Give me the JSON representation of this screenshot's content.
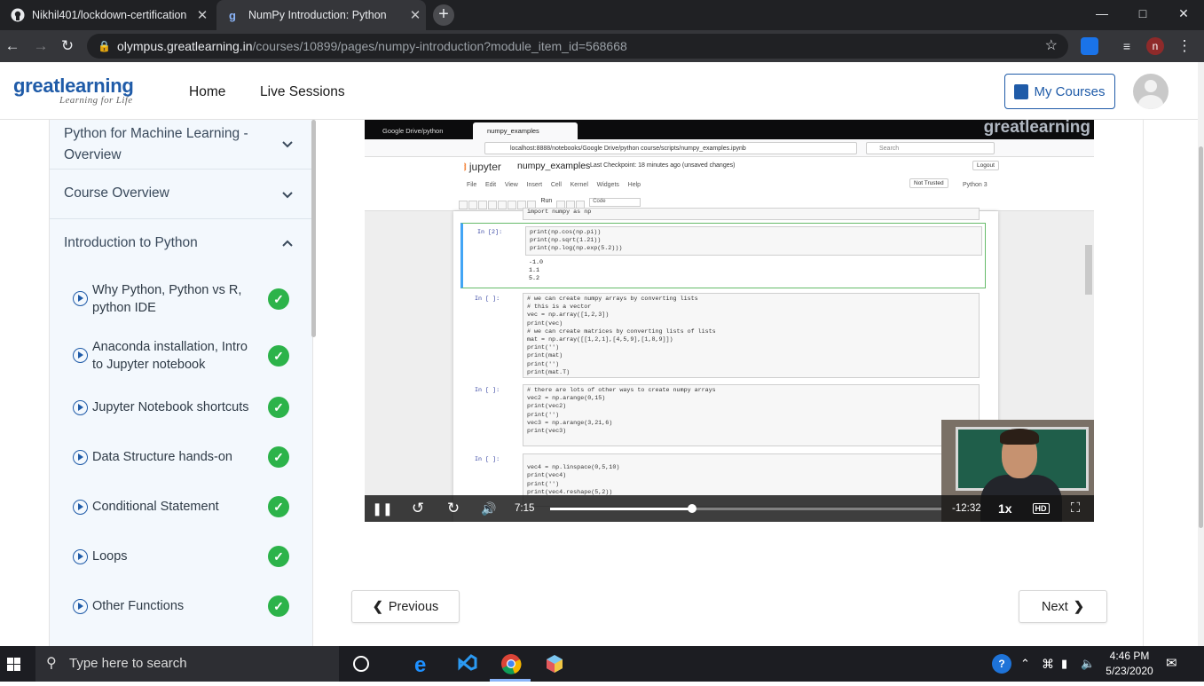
{
  "browser": {
    "tabs": [
      {
        "title": "Nikhil401/lockdown-certification",
        "close": "✕",
        "icon": "github-icon"
      },
      {
        "title": "NumPy Introduction: Python",
        "close": "✕",
        "icon": "greatlearning-icon"
      }
    ],
    "new_tab": "+",
    "url_host": "olympus.greatlearning.in",
    "url_path": "/courses/10899/pages/numpy-introduction?module_item_id=568668",
    "profile_initial": "n"
  },
  "header": {
    "logo_main": "greatlearning",
    "logo_sub": "Learning for Life",
    "nav": [
      "Home",
      "Live Sessions"
    ],
    "my_courses": "My Courses"
  },
  "sidebar": {
    "sections": [
      {
        "title": "Python for Machine Learning - Overview",
        "expanded": false
      },
      {
        "title": "Course Overview",
        "expanded": false
      },
      {
        "title": "Introduction to Python",
        "expanded": true
      }
    ],
    "lessons": [
      {
        "title": "Why Python, Python vs R, python IDE",
        "done": true
      },
      {
        "title": "Anaconda installation, Intro to Jupyter notebook",
        "done": true
      },
      {
        "title": "Jupyter Notebook shortcuts",
        "done": true
      },
      {
        "title": "Data Structure hands-on",
        "done": true
      },
      {
        "title": "Conditional Statement",
        "done": true
      },
      {
        "title": "Loops",
        "done": true
      },
      {
        "title": "Other Functions",
        "done": true
      }
    ],
    "check": "✓"
  },
  "video": {
    "inner_tabs": [
      "Google Drive/python course/s",
      "numpy_examples"
    ],
    "watermark": "greatlearning",
    "inner_url": "localhost:8888/notebooks/Google Drive/python course/scripts/numpy_examples.ipynb",
    "inner_search": "Search",
    "jupyter_logo": "jupyter",
    "notebook_name": "numpy_examples",
    "checkpoint": "Last Checkpoint: 18 minutes ago  (unsaved changes)",
    "logout": "Logout",
    "menu": [
      "File",
      "Edit",
      "View",
      "Insert",
      "Cell",
      "Kernel",
      "Widgets",
      "Help"
    ],
    "trust": "Not Trusted",
    "kernel": "Python 3",
    "run_label": "Run",
    "cell_type": "Code",
    "cells": [
      {
        "prompt": "",
        "code": "import numpy as np",
        "output": ""
      },
      {
        "prompt": "In [2]:",
        "code": "print(np.cos(np.pi))\nprint(np.sqrt(1.21))\nprint(np.log(np.exp(5.2)))",
        "output": "-1.0\n1.1\n5.2"
      },
      {
        "prompt": "In [ ]:",
        "code": "# we can create numpy arrays by converting lists\n# this is a vector\nvec = np.array([1,2,3])\nprint(vec)\n# we can create matrices by converting lists of lists\nmat = np.array([[1,2,1],[4,5,9],[1,8,9]])\nprint('')\nprint(mat)\nprint('')\nprint(mat.T)",
        "output": ""
      },
      {
        "prompt": "In [ ]:",
        "code": "# there are lots of other ways to create numpy arrays\nvec2 = np.arange(0,15)\nprint(vec2)\nprint('')\nvec3 = np.arange(3,21,6)\nprint(vec3)",
        "output": ""
      },
      {
        "prompt": "In [ ]:",
        "code": "\nvec4 = np.linspace(0,5,10)\nprint(vec4)\nprint('')\nprint(vec4.reshape(5,2))",
        "output": ""
      }
    ],
    "current_time": "7:15",
    "remaining_time": "-12:32",
    "speed": "1x",
    "progress": 0.363
  },
  "pager": {
    "previous": "Previous",
    "next": "Next"
  },
  "taskbar": {
    "search_placeholder": "Type here to search",
    "time": "4:46 PM",
    "date": "5/23/2020"
  },
  "colors": {
    "brand": "#1f5ba8",
    "done": "#2cb34a",
    "sidebar_bg": "#f3f8fd"
  }
}
